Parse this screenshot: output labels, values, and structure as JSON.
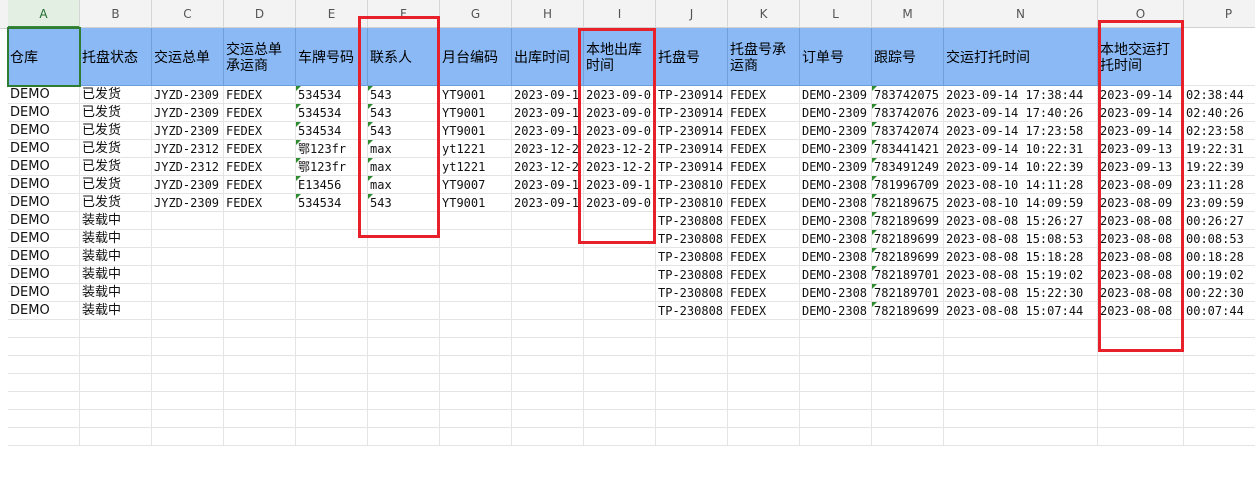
{
  "columns": [
    "A",
    "B",
    "C",
    "D",
    "E",
    "F",
    "G",
    "H",
    "I",
    "J",
    "K",
    "L",
    "M",
    "N",
    "O",
    "P"
  ],
  "headers": [
    "仓库",
    "托盘状态",
    "交运总单",
    "交运总单承运商",
    "车牌号码",
    "联系人",
    "月台编码",
    "出库时间",
    "本地出库时间",
    "托盘号",
    "托盘号承运商",
    "订单号",
    "跟踪号",
    "交运打托时间",
    "本地交运打托时间",
    ""
  ],
  "rows": [
    [
      "DEMO",
      "已发货",
      "JYZD-2309",
      "FEDEX",
      "534534",
      "543",
      "YT9001",
      "2023-09-1",
      "2023-09-0",
      "TP-230914",
      "FEDEX",
      "DEMO-2309",
      "783742075",
      "2023-09-14 17:38:44",
      "2023-09-14",
      "02:38:44"
    ],
    [
      "DEMO",
      "已发货",
      "JYZD-2309",
      "FEDEX",
      "534534",
      "543",
      "YT9001",
      "2023-09-1",
      "2023-09-0",
      "TP-230914",
      "FEDEX",
      "DEMO-2309",
      "783742076",
      "2023-09-14 17:40:26",
      "2023-09-14",
      "02:40:26"
    ],
    [
      "DEMO",
      "已发货",
      "JYZD-2309",
      "FEDEX",
      "534534",
      "543",
      "YT9001",
      "2023-09-1",
      "2023-09-0",
      "TP-230914",
      "FEDEX",
      "DEMO-2309",
      "783742074",
      "2023-09-14 17:23:58",
      "2023-09-14",
      "02:23:58"
    ],
    [
      "DEMO",
      "已发货",
      "JYZD-2312",
      "FEDEX",
      "鄂123fr",
      "max",
      "yt1221",
      "2023-12-2",
      "2023-12-2",
      "TP-230914",
      "FEDEX",
      "DEMO-2309",
      "783441421",
      "2023-09-14 10:22:31",
      "2023-09-13",
      "19:22:31"
    ],
    [
      "DEMO",
      "已发货",
      "JYZD-2312",
      "FEDEX",
      "鄂123fr",
      "max",
      "yt1221",
      "2023-12-2",
      "2023-12-2",
      "TP-230914",
      "FEDEX",
      "DEMO-2309",
      "783491249",
      "2023-09-14 10:22:39",
      "2023-09-13",
      "19:22:39"
    ],
    [
      "DEMO",
      "已发货",
      "JYZD-2309",
      "FEDEX",
      "E13456",
      "max",
      "YT9007",
      "2023-09-1",
      "2023-09-1",
      "TP-230810",
      "FEDEX",
      "DEMO-2308",
      "781996709",
      "2023-08-10 14:11:28",
      "2023-08-09",
      "23:11:28"
    ],
    [
      "DEMO",
      "已发货",
      "JYZD-2309",
      "FEDEX",
      "534534",
      "543",
      "YT9001",
      "2023-09-1",
      "2023-09-0",
      "TP-230810",
      "FEDEX",
      "DEMO-2308",
      "782189675",
      "2023-08-10 14:09:59",
      "2023-08-09",
      "23:09:59"
    ],
    [
      "DEMO",
      "装载中",
      "",
      "",
      "",
      "",
      "",
      "",
      "",
      "TP-230808",
      "FEDEX",
      "DEMO-2308",
      "782189699",
      "2023-08-08 15:26:27",
      "2023-08-08",
      "00:26:27"
    ],
    [
      "DEMO",
      "装载中",
      "",
      "",
      "",
      "",
      "",
      "",
      "",
      "TP-230808",
      "FEDEX",
      "DEMO-2308",
      "782189699",
      "2023-08-08 15:08:53",
      "2023-08-08",
      "00:08:53"
    ],
    [
      "DEMO",
      "装载中",
      "",
      "",
      "",
      "",
      "",
      "",
      "",
      "TP-230808",
      "FEDEX",
      "DEMO-2308",
      "782189699",
      "2023-08-08 15:18:28",
      "2023-08-08",
      "00:18:28"
    ],
    [
      "DEMO",
      "装载中",
      "",
      "",
      "",
      "",
      "",
      "",
      "",
      "TP-230808",
      "FEDEX",
      "DEMO-2308",
      "782189701",
      "2023-08-08 15:19:02",
      "2023-08-08",
      "00:19:02"
    ],
    [
      "DEMO",
      "装载中",
      "",
      "",
      "",
      "",
      "",
      "",
      "",
      "TP-230808",
      "FEDEX",
      "DEMO-2308",
      "782189701",
      "2023-08-08 15:22:30",
      "2023-08-08",
      "00:22:30"
    ],
    [
      "DEMO",
      "装载中",
      "",
      "",
      "",
      "",
      "",
      "",
      "",
      "TP-230808",
      "FEDEX",
      "DEMO-2308",
      "782189699",
      "2023-08-08 15:07:44",
      "2023-08-08",
      "00:07:44"
    ]
  ],
  "colors": {
    "header_fill": "#8ab9f5",
    "highlight": "#e8202a",
    "active_cell": "#2e7d32"
  }
}
